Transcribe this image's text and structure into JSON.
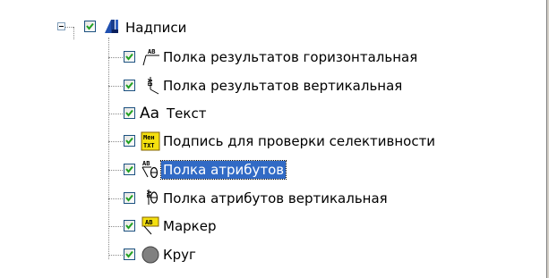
{
  "tree": {
    "parent": {
      "label": "Надписи",
      "checked": true,
      "expanded": true,
      "icon": "labels-folder-icon"
    },
    "children": [
      {
        "label": "Полка результатов горизонтальная",
        "checked": true,
        "icon": "shelf-horizontal-icon"
      },
      {
        "label": "Полка результатов вертикальная",
        "checked": true,
        "icon": "shelf-vertical-icon"
      },
      {
        "label": "Текст",
        "checked": true,
        "icon": "text-icon"
      },
      {
        "label": "Подпись для проверки селективности",
        "checked": true,
        "icon": "selectivity-caption-icon"
      },
      {
        "label": "Полка атрибутов",
        "checked": true,
        "icon": "attribute-shelf-icon",
        "selected": true
      },
      {
        "label": "Полка атрибутов вертикальная",
        "checked": true,
        "icon": "attribute-shelf-vertical-icon"
      },
      {
        "label": "Маркер",
        "checked": true,
        "icon": "marker-icon"
      },
      {
        "label": "Круг",
        "checked": true,
        "icon": "circle-icon"
      }
    ],
    "icon_glyphs": {
      "text_icon": "Aa",
      "caption_icon_top": "Мен",
      "caption_icon_bottom": "ТХТ",
      "small_label": "АВ"
    }
  },
  "colors": {
    "selection": "#316ac5",
    "check": "#21a121",
    "circle": "#808080"
  }
}
